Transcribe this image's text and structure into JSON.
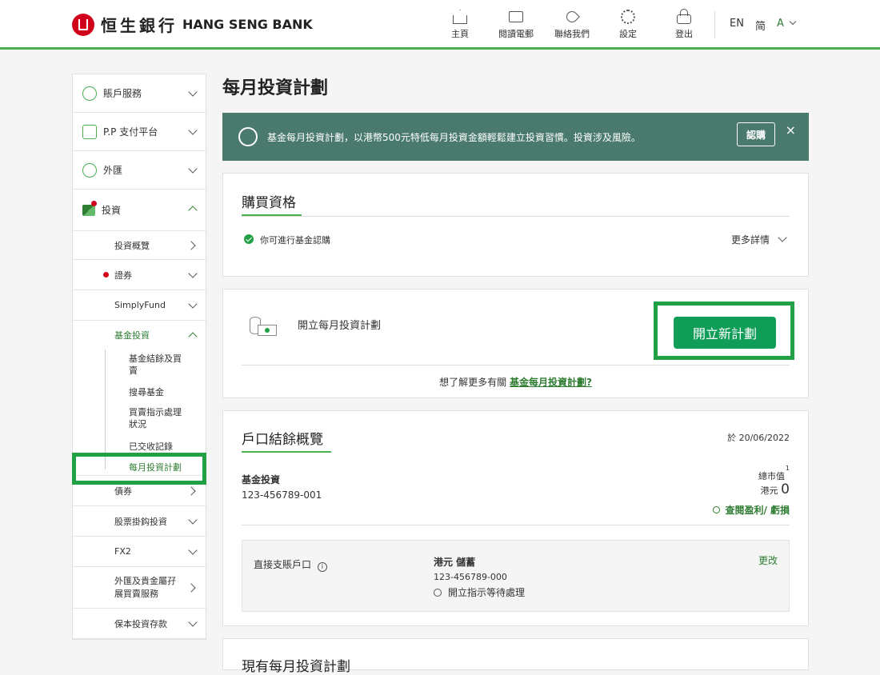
{
  "header": {
    "logo_cn": "恒生銀行",
    "logo_en": "HANG SENG BANK",
    "nav": [
      {
        "label": "主頁",
        "icon": "home-icon"
      },
      {
        "label": "閱讀電郵",
        "icon": "mail-icon"
      },
      {
        "label": "聯絡我們",
        "icon": "phone-icon"
      },
      {
        "label": "設定",
        "icon": "gear-icon"
      },
      {
        "label": "登出",
        "icon": "lock-icon"
      }
    ],
    "lang_en": "EN",
    "lang_sc": "简",
    "font_size": "A"
  },
  "sidebar": {
    "top_items": [
      {
        "label": "賬戶服務",
        "icon": "user-icon"
      },
      {
        "label": "P.P 支付平台",
        "icon": "payment-icon"
      },
      {
        "label": "外匯",
        "icon": "fx-icon"
      },
      {
        "label": "投資",
        "icon": "invest-icon"
      }
    ],
    "sub_items": {
      "overview": "投資概覽",
      "securities": "證券",
      "simplyfund": "SimplyFund",
      "fund": "基金投資",
      "bonds": "債券",
      "equity_linked": "股票掛鈎投資",
      "fx2": "FX2",
      "precious": "外匯及貴金屬孖展買賣服務",
      "principal": "保本投資存款"
    },
    "fund_leaves": [
      "基金結餘及買賣",
      "搜尋基金",
      "買賣指示處理狀況",
      "已交收記錄",
      "每月投資計劃"
    ]
  },
  "main": {
    "title": "每月投資計劃",
    "banner": {
      "text": "基金每月投資計劃，以港幣500元特低每月投資金額輕鬆建立投資習慣。投資涉及風險。",
      "button": "認購",
      "close": "×"
    },
    "eligibility": {
      "title": "購買資格",
      "status": "你可進行基金認購",
      "more": "更多詳情"
    },
    "open_plan": {
      "title": "開立每月投資計劃",
      "button": "開立新計劃",
      "learn_prefix": "想了解更多有關",
      "learn_link": "基金每月投資計劃?"
    },
    "balance": {
      "title": "戶口結餘概覽",
      "date_prefix": "於",
      "date": "20/06/2022",
      "account_type": "基金投資",
      "account_no": "123-456789-001",
      "market_value_label": "總市值",
      "footnote": "1",
      "currency": "港元",
      "value": "0",
      "pl_link": "查閱盈利/ 虧損",
      "debit_label": "直接支賬戶口",
      "debit_account_type": "港元 儲蓄",
      "debit_account_no": "123-456789-000",
      "debit_status": "開立指示等待處理",
      "change": "更改"
    },
    "next_title": "現有每月投資計劃"
  },
  "colors": {
    "brand_red": "#d0021b",
    "accent_green": "#22a045",
    "banner": "#4a7a6d"
  }
}
